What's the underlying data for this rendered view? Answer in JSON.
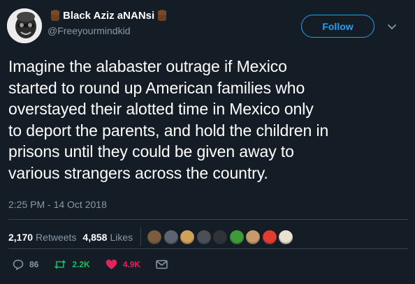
{
  "author": {
    "display_name": "Black Aziz aNANsi",
    "handle": "@Freeyourmindkid"
  },
  "follow_button_label": "Follow",
  "tweet": {
    "text_lines": [
      "Imagine the alabaster outrage if Mexico",
      "started to round up American families who",
      "overstayed their alotted time in Mexico only",
      "to deport the parents, and hold the children in",
      "prisons until they could be given away to",
      "various strangers across the country."
    ],
    "timestamp": "2:25 PM - 14 Oct 2018"
  },
  "stats": {
    "retweets_count": "2,170",
    "retweets_label": "Retweets",
    "likes_count": "4,858",
    "likes_label": "Likes"
  },
  "likers": [
    {
      "icon": "liker-avatar-1",
      "color": "#7a5c3e"
    },
    {
      "icon": "liker-avatar-2",
      "color": "#5b6470"
    },
    {
      "icon": "liker-avatar-3",
      "color": "#d1a25a"
    },
    {
      "icon": "liker-avatar-4",
      "color": "#4a4f58"
    },
    {
      "icon": "liker-avatar-5",
      "color": "#2f3338"
    },
    {
      "icon": "liker-avatar-6",
      "color": "#3f9a3a"
    },
    {
      "icon": "liker-avatar-7",
      "color": "#c79a6a"
    },
    {
      "icon": "liker-avatar-8",
      "color": "#e23b2f"
    },
    {
      "icon": "liker-avatar-9",
      "color": "#e9e2d0"
    }
  ],
  "actions": {
    "reply_count": "86",
    "retweet_count": "2.2K",
    "like_count": "4.9K"
  },
  "colors": {
    "background": "#141d26",
    "accent": "#1da1f2",
    "muted": "#8899a6",
    "retweet": "#17bf63",
    "like": "#e0245e",
    "divider": "#38444d"
  },
  "icons": {
    "caret": "chevron-down-icon",
    "fist": "raised-fist-icon",
    "reply": "reply-icon",
    "retweet": "retweet-icon",
    "like": "heart-icon",
    "dm": "envelope-icon"
  }
}
